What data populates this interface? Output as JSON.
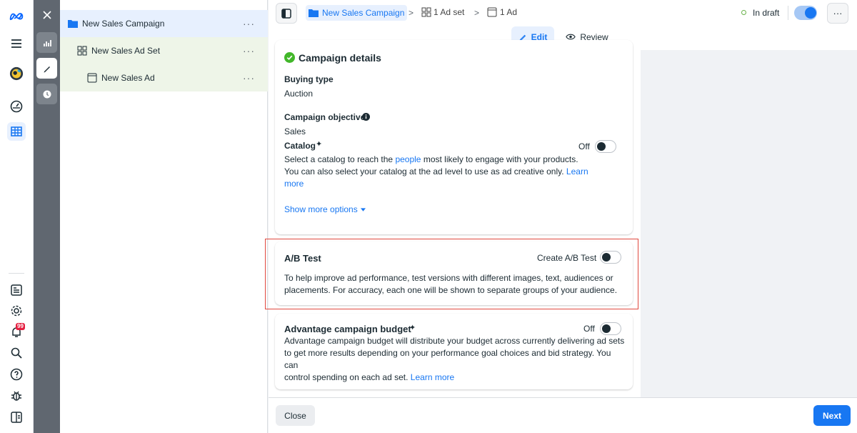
{
  "colors": {
    "accent": "#1877f2",
    "draft": "#69b24a",
    "highlight": "#e0483e"
  },
  "tree": {
    "campaign": "New Sales Campaign",
    "adset": "New Sales Ad Set",
    "ad": "New Sales Ad",
    "more": "···"
  },
  "rail": {
    "notif_count": "99"
  },
  "breadcrumb": {
    "campaign": "New Sales Campaign",
    "adset": "1 Ad set",
    "ad": "1 Ad",
    "sep": ">"
  },
  "header": {
    "status": "In draft",
    "more": "···",
    "edit": "Edit",
    "review": "Review"
  },
  "campaign_details": {
    "title": "Campaign details",
    "buying_type_label": "Buying type",
    "buying_type_value": "Auction",
    "objective_label": "Campaign objective",
    "objective_value": "Sales",
    "catalog_label": "Catalog",
    "catalog_toggle": "Off",
    "catalog_text_1": "Select a catalog to reach the ",
    "catalog_link_people": "people",
    "catalog_text_2": " most likely to engage with your products.",
    "catalog_text_3": "You can also select your catalog at the ad level to use as ad creative only. ",
    "catalog_learn": "Learn",
    "catalog_more": "more",
    "show_more": "Show more options"
  },
  "ab_test": {
    "title": "A/B Test",
    "toggle_label": "Create A/B Test",
    "text_1": "To help improve ad performance, test versions with different images, text, audiences or",
    "text_2": "placements. For accuracy, each one will be shown to separate groups of your audience."
  },
  "budget": {
    "title": "Advantage campaign budget",
    "toggle": "Off",
    "text_1": "Advantage campaign budget will distribute your budget across currently delivering ad sets",
    "text_2": "to get more results depending on your performance goal choices and bid strategy. You can",
    "text_3": "control spending on each ad set. ",
    "learn_more": "Learn more"
  },
  "footer": {
    "close": "Close",
    "next": "Next"
  }
}
